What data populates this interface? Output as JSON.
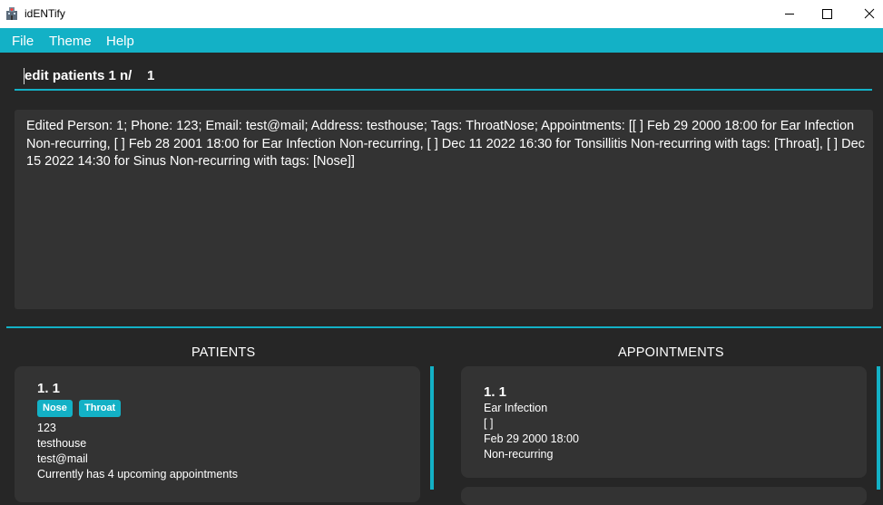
{
  "window": {
    "title": "idENTify",
    "icon": "hospital-icon"
  },
  "menu": [
    "File",
    "Theme",
    "Help"
  ],
  "command": {
    "value": "edit patients 1 n/    1"
  },
  "result": {
    "text": "Edited Person: 1; Phone: 123; Email: test@mail; Address: testhouse; Tags: ThroatNose; Appointments: [[ ] Feb 29 2000 18:00 for Ear Infection Non-recurring, [ ] Feb 28 2001 18:00 for Ear Infection Non-recurring, [ ] Dec 11 2022 16:30 for Tonsillitis Non-recurring with tags: [Throat], [ ] Dec 15 2022 14:30 for Sinus Non-recurring with tags: [Nose]]"
  },
  "patients": {
    "title": "PATIENTS",
    "items": [
      {
        "id": "1.  1",
        "tags": [
          "Nose",
          "Throat"
        ],
        "phone": "123",
        "address": "testhouse",
        "email": "test@mail",
        "summary": "Currently has 4 upcoming appointments"
      }
    ]
  },
  "appointments": {
    "title": "APPOINTMENTS",
    "items": [
      {
        "id": "1.  1",
        "reason": "Ear Infection",
        "tags": "[ ]",
        "datetime": "Feb 29 2000 18:00",
        "recurrence": "Non-recurring"
      }
    ]
  },
  "colors": {
    "accent": "#13b1c6",
    "background": "#262626",
    "panel": "#333333"
  }
}
